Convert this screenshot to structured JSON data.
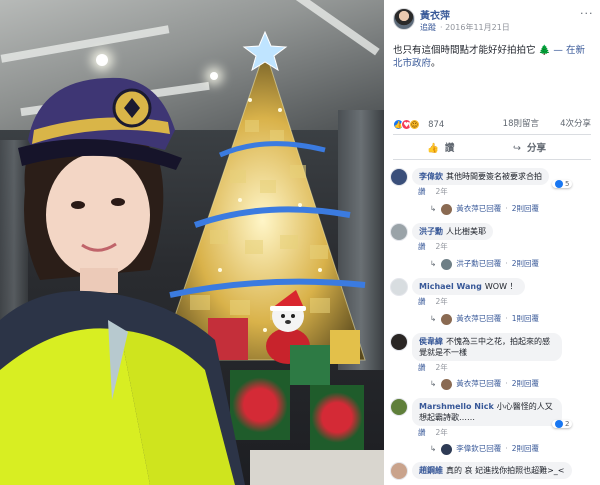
{
  "post": {
    "author": "黃衣萍",
    "follow_label": "追蹤",
    "date": "2016年11月21日",
    "more_label": "···",
    "text": "也只有這個時間點才能好好拍拍它",
    "tree_emoji": "🌲",
    "location_prefix": "— 在",
    "location": "新北市政府",
    "location_suffix": "。",
    "reactions_total": "874",
    "comments_count": "18則留言",
    "shares_count": "4次分享",
    "like_label": "讚",
    "share_label": "分享",
    "like_icon": "thumbs-up-icon",
    "share_icon": "share-arrow-icon"
  },
  "comments": [
    {
      "name": "李偉欽",
      "text": "其他時間要簽名被要求合拍",
      "like_label": "讚",
      "time": "2年",
      "likes": "5",
      "reply_author": "黃衣萍",
      "reply_text": "已回覆",
      "reply_count": "2則回覆"
    },
    {
      "name": "洪子勳",
      "text": "人比樹美耶",
      "like_label": "讚",
      "time": "2年",
      "likes": "",
      "reply_author": "洪子勳",
      "reply_text": "已回覆",
      "reply_count": "2則回覆"
    },
    {
      "name": "Michael Wang",
      "text": "WOW ！",
      "like_label": "讚",
      "time": "2年",
      "likes": "",
      "reply_author": "黃衣萍",
      "reply_text": "已回覆",
      "reply_count": "1則回覆"
    },
    {
      "name": "侯韋緯",
      "text": "不愧為三中之花，拍起來的感覺就是不一樣",
      "like_label": "讚",
      "time": "2年",
      "likes": "",
      "reply_author": "黃衣萍",
      "reply_text": "已回覆",
      "reply_count": "2則回覆"
    },
    {
      "name": "Marshmello Nick",
      "text": "小心醫怪的人又想起霸詩歌……",
      "like_label": "讚",
      "time": "2年",
      "likes": "2",
      "reply_author": "李偉欽",
      "reply_text": "已回覆",
      "reply_count": "2則回覆"
    },
    {
      "name": "趙鋼維",
      "text": "真的 哀 妃進找你拍照也超難>_<",
      "like_label": "讚",
      "time": "2年",
      "likes": "",
      "reply_author": "",
      "reply_text": "",
      "reply_count": ""
    }
  ],
  "colors": {
    "link": "#385898",
    "like": "#1877f2",
    "love": "#f33e58",
    "haha": "#f7b928",
    "bubble": "#f2f3f5"
  }
}
